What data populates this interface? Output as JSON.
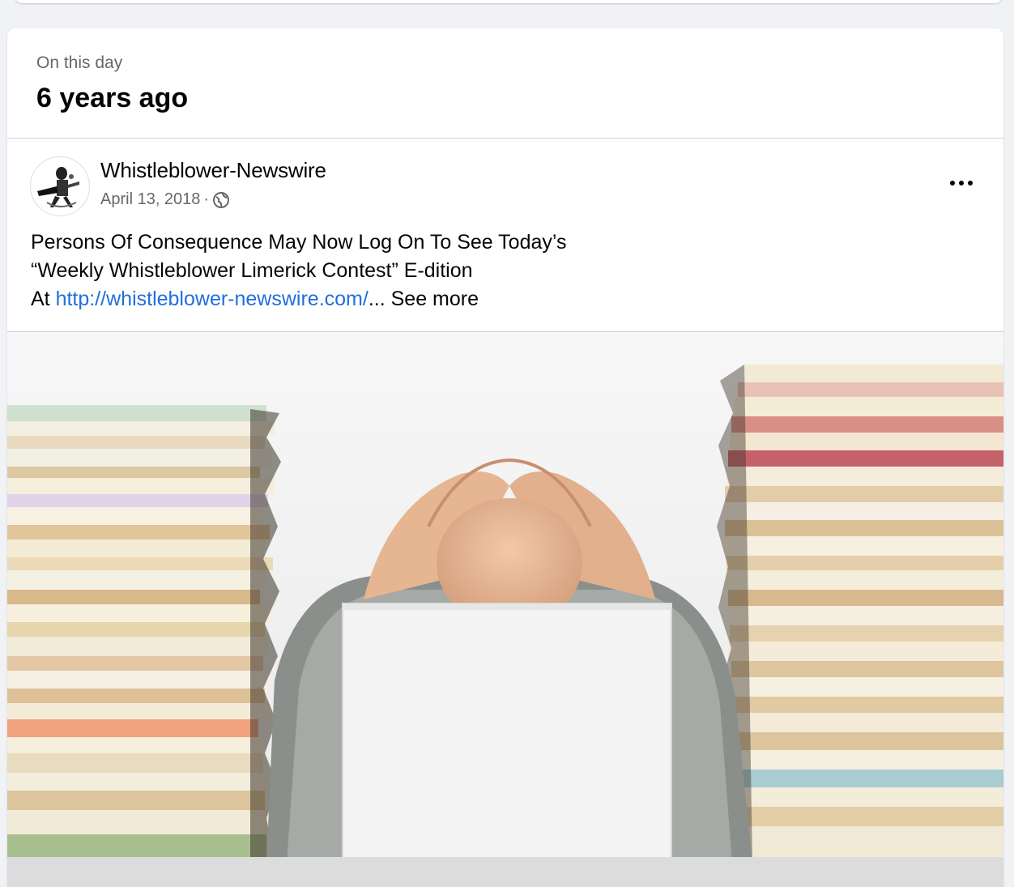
{
  "memory": {
    "eyebrow": "On this day",
    "headline": "6 years ago"
  },
  "post": {
    "author": "Whistleblower-Newswire",
    "date": "April 13, 2018",
    "separator": "·",
    "privacy_icon": "globe-icon",
    "more_icon": "more-options-icon",
    "text_line1": "Persons Of Consequence May Now Log On To See Today’s",
    "text_line2": "“Weekly Whistleblower Limerick Contest” E-dition",
    "text_line3_prefix": "At ",
    "link_text": "http://whistleblower-newswire.com/",
    "ellipsis": "...",
    "see_more": "See more"
  },
  "image": {
    "subject": "stressed-worker-between-file-stacks"
  },
  "colors": {
    "link": "#216fdb",
    "secondary_text": "#65676b",
    "background": "#f0f2f5"
  }
}
